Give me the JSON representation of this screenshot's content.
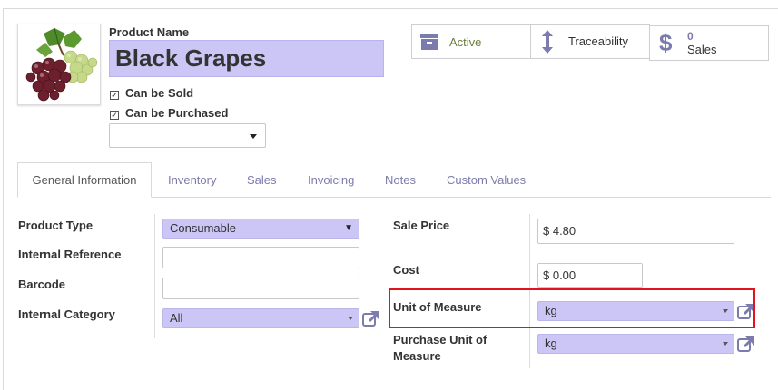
{
  "product": {
    "name_label": "Product Name",
    "name_value": "Black Grapes",
    "can_be_sold_label": "Can be Sold",
    "can_be_purchased_label": "Can be Purchased",
    "can_be_sold_checked": true,
    "can_be_purchased_checked": true,
    "image_icon": "grapes-product-image"
  },
  "stat_buttons": {
    "active_label": "Active",
    "traceability_label": "Traceability",
    "sales_count": "0",
    "sales_label": "Sales",
    "active_icon": "archive-icon",
    "traceability_icon": "up-down-arrow-icon",
    "sales_icon": "dollar-icon"
  },
  "tabs": [
    {
      "label": "General Information",
      "active": true
    },
    {
      "label": "Inventory"
    },
    {
      "label": "Sales"
    },
    {
      "label": "Invoicing"
    },
    {
      "label": "Notes"
    },
    {
      "label": "Custom Values"
    }
  ],
  "left_fields": {
    "product_type_label": "Product Type",
    "product_type_value": "Consumable",
    "internal_reference_label": "Internal Reference",
    "internal_reference_value": "",
    "barcode_label": "Barcode",
    "barcode_value": "",
    "internal_category_label": "Internal Category",
    "internal_category_value": "All"
  },
  "right_fields": {
    "sale_price_label": "Sale Price",
    "sale_price_value": "$ 4.80",
    "cost_label": "Cost",
    "cost_value": "$ 0.00",
    "uom_label": "Unit of Measure",
    "uom_value": "kg",
    "purchase_uom_label_1": "Purchase Unit of",
    "purchase_uom_label_2": "Measure",
    "purchase_uom_value": "kg"
  },
  "colors": {
    "accent_purple": "#7c7bad",
    "required_field_bg": "#cbc6f5",
    "highlight_red": "#e0131f"
  }
}
